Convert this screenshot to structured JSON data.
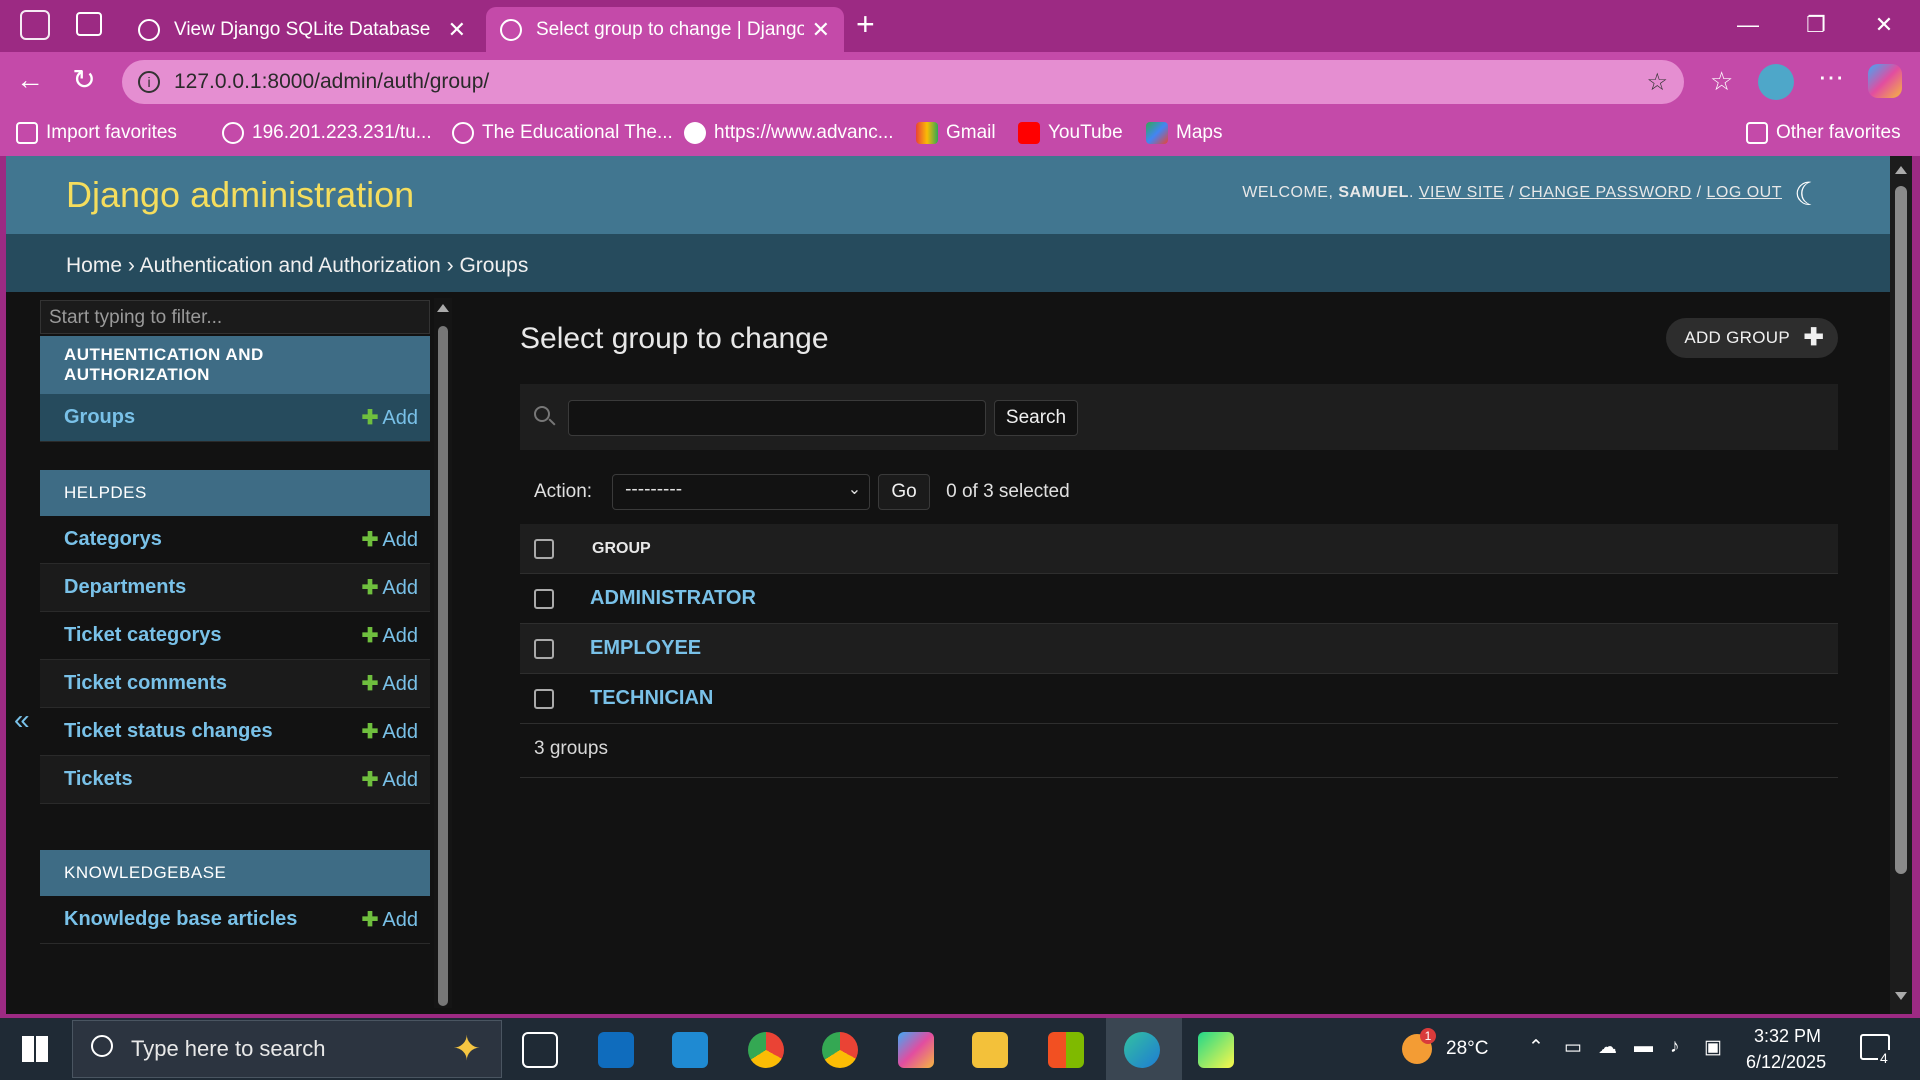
{
  "browser": {
    "tabs": [
      {
        "label": "View Django SQLite Database",
        "active": false
      },
      {
        "label": "Select group to change | Django site admin",
        "active": true
      }
    ],
    "address": "127.0.0.1:8000/admin/auth/group/",
    "bookmarks": [
      "Import favorites",
      "196.201.223.231/tu...",
      "The Educational The...",
      "https://www.advanc...",
      "Gmail",
      "YouTube",
      "Maps"
    ],
    "other_favorites": "Other favorites"
  },
  "admin": {
    "site_title": "Django administration",
    "user_tools": {
      "welcome": "WELCOME,",
      "username": "SAMUEL",
      "view_site": "VIEW SITE",
      "change_password": "CHANGE PASSWORD",
      "log_out": "LOG OUT"
    },
    "breadcrumbs": {
      "home": "Home",
      "sep": "›",
      "app": "Authentication and Authorization",
      "model": "Groups"
    }
  },
  "sidebar": {
    "filter_placeholder": "Start typing to filter...",
    "modules": [
      {
        "title": "AUTHENTICATION AND AUTHORIZATION",
        "rows": [
          "Groups"
        ]
      },
      {
        "title": "HELPDES",
        "rows": [
          "Categorys",
          "Departments",
          "Ticket categorys",
          "Ticket comments",
          "Ticket status changes",
          "Tickets"
        ]
      },
      {
        "title": "KNOWLEDGEBASE",
        "rows": [
          "Knowledge base articles"
        ]
      }
    ],
    "add_label": "Add",
    "collapse": "«"
  },
  "content": {
    "title": "Select group to change",
    "add_button": "ADD GROUP",
    "search_button": "Search",
    "action_label": "Action:",
    "action_selected": "---------",
    "go_button": "Go",
    "selected_counter": "0 of 3 selected",
    "column_header": "GROUP",
    "groups": [
      "ADMINISTRATOR",
      "EMPLOYEE",
      "TECHNICIAN"
    ],
    "paginator": "3 groups"
  },
  "taskbar": {
    "search_placeholder": "Type here to search",
    "weather": "28°C",
    "weather_badge": "1",
    "time": "3:32 PM",
    "date": "6/12/2025",
    "notification_count": "4"
  },
  "colors": {
    "browser_frame": "#9c2a83",
    "django_header": "#417690",
    "breadcrumb_bar": "#264b5d",
    "site_title": "#f5dd5d",
    "link": "#79c1e8",
    "add_plus": "#6fbf3e"
  }
}
